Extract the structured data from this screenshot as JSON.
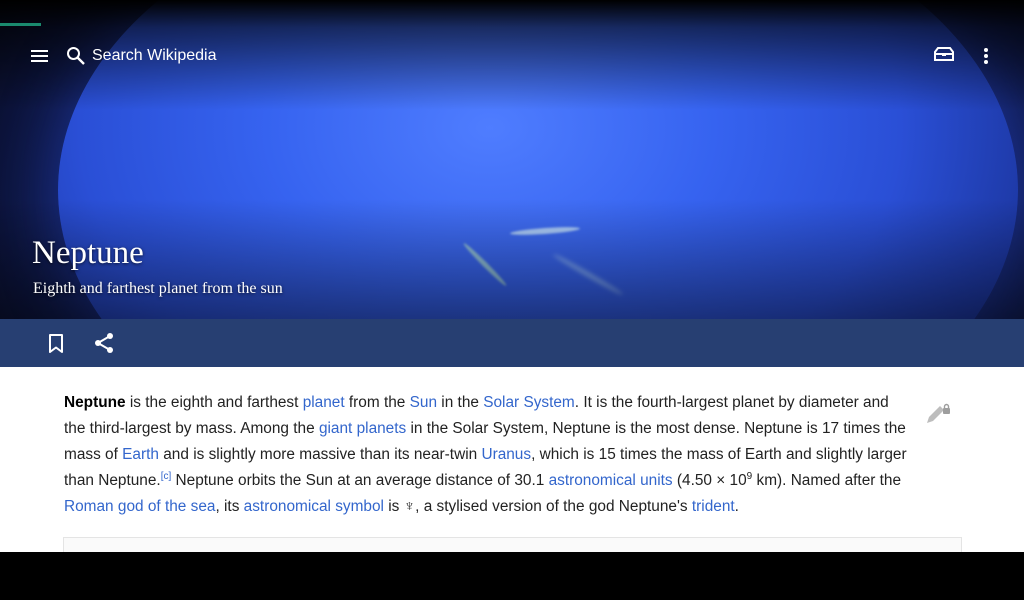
{
  "header": {
    "search_placeholder": "Search Wikipedia"
  },
  "article": {
    "title": "Neptune",
    "description": "Eighth and farthest planet from the sun"
  },
  "lead": {
    "p1": "Neptune",
    "p2": " is the eighth and farthest ",
    "l_planet": "planet",
    "p3": " from the ",
    "l_sun": "Sun",
    "p4": " in the ",
    "l_solar_system": "Solar System",
    "p5": ". It is the fourth-largest planet by diameter and the third-largest by mass. Among the ",
    "l_giant_planets": "giant planets",
    "p6": " in the Solar System, Neptune is the most dense. Neptune is 17 times the mass of ",
    "l_earth": "Earth",
    "p7": " and is slightly more massive than its near-twin ",
    "l_uranus": "Uranus",
    "p8": ", which is 15 times the mass of Earth and slightly larger than Neptune.",
    "note_c": "[c]",
    "p9": " Neptune orbits the Sun at an average distance of 30.1 ",
    "l_au": "astronomical units",
    "p10": " (4.50 × 10",
    "exp": "9",
    "p11": " km). Named after the ",
    "l_roman_god": "Roman god of the sea",
    "p12": ", its ",
    "l_astro_symbol": "astronomical symbol",
    "p13": " is ♆, a stylised version of the god Neptune's ",
    "l_trident": "trident",
    "p14": "."
  },
  "colors": {
    "action_bar": "#273f72",
    "link": "#3366cc",
    "progress": "#1a8a6e"
  },
  "icons": [
    "menu-icon",
    "search-icon",
    "reading-list-icon",
    "more-vert-icon",
    "bookmark-icon",
    "share-icon",
    "edit-lock-icon"
  ]
}
